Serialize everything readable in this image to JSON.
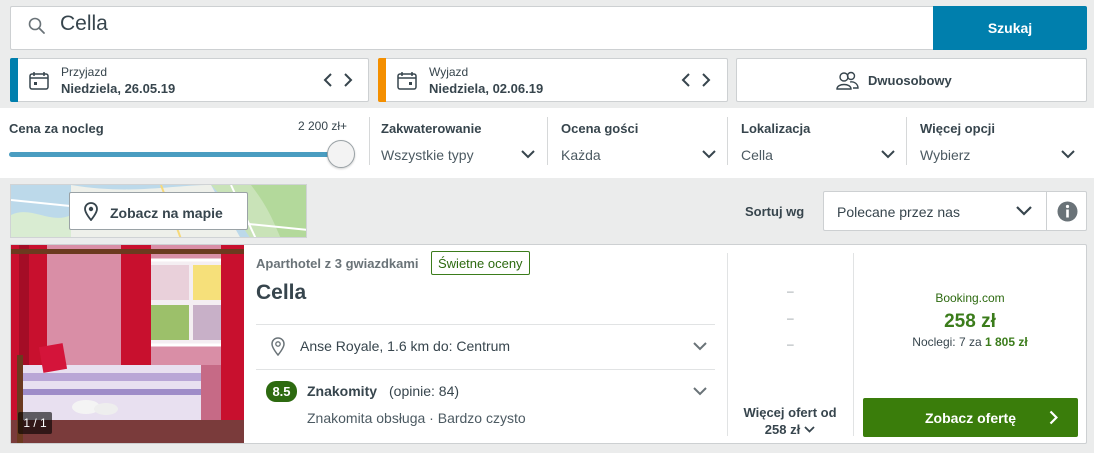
{
  "search": {
    "query": "Cella",
    "button_label": "Szukaj"
  },
  "checkin": {
    "label": "Przyjazd",
    "value": "Niedziela, 26.05.19",
    "accent": "#007fad"
  },
  "checkout": {
    "label": "Wyjazd",
    "value": "Niedziela, 02.06.19",
    "accent": "#f48f00"
  },
  "room": {
    "label": "Dwuosobowy",
    "icon": "people-icon"
  },
  "filters": {
    "price": {
      "title": "Cena za nocleg",
      "max_label": "2 200 zł+",
      "level": 1.0
    },
    "items": [
      {
        "title": "Zakwaterowanie",
        "value": "Wszystkie typy"
      },
      {
        "title": "Ocena gości",
        "value": "Każda"
      },
      {
        "title": "Lokalizacja",
        "value": "Cella"
      },
      {
        "title": "Więcej opcji",
        "value": "Wybierz"
      }
    ]
  },
  "map": {
    "button_label": "Zobacz na mapie"
  },
  "sort": {
    "label": "Sortuj wg",
    "value": "Polecane przez nas"
  },
  "result": {
    "photo_count": "1 / 1",
    "hotel_type": "Aparthotel z 3 gwiazdkami",
    "badge": "Świetne oceny",
    "name": "Cella",
    "location": "Anse Royale, 1.6 km do: Centrum",
    "rating": {
      "score": "8.5",
      "word": "Znakomity",
      "count": "(opinie: 84)",
      "highlights": "Znakomita obsługa · Bardzo czysto"
    },
    "alt_prices": [
      "–",
      "–",
      "–"
    ],
    "more_offers": {
      "line1": "Więcej ofert od",
      "line2": "258 zł"
    },
    "deal": {
      "provider": "Booking.com",
      "price": "258 zł",
      "nights_prefix": "Noclegi: 7 za",
      "nights_total": "1 805 zł",
      "button_label": "Zobacz ofertę"
    }
  },
  "colors": {
    "primary_blue": "#007fad",
    "deal_green": "#3a7d0b",
    "rating_green": "#2d6a10",
    "checkout_orange": "#f48f00"
  }
}
